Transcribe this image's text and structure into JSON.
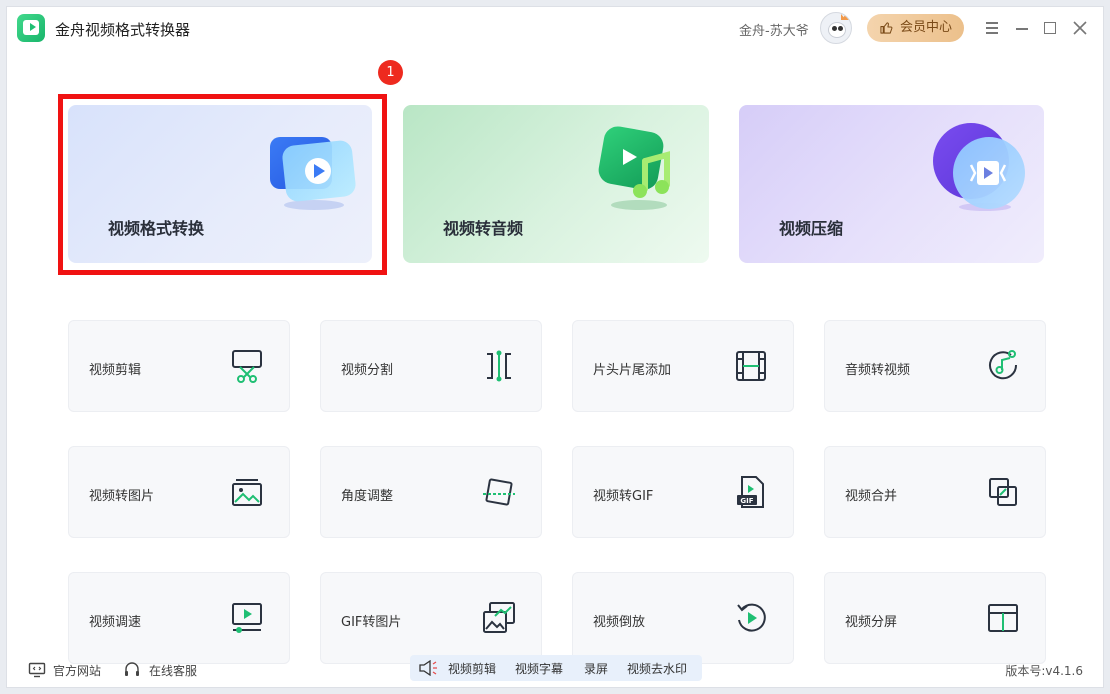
{
  "app": {
    "title": "金舟视频格式转换器"
  },
  "header": {
    "user_name": "金舟-苏大爷",
    "vip_label": "会员中心"
  },
  "annotation": {
    "step_number": "1"
  },
  "feature_cards": [
    {
      "label": "视频格式转换"
    },
    {
      "label": "视频转音频"
    },
    {
      "label": "视频压缩"
    }
  ],
  "tools": [
    {
      "label": "视频剪辑"
    },
    {
      "label": "视频分割"
    },
    {
      "label": "片头片尾添加"
    },
    {
      "label": "音频转视频"
    },
    {
      "label": "视频转图片"
    },
    {
      "label": "角度调整"
    },
    {
      "label": "视频转GIF"
    },
    {
      "label": "视频合并"
    },
    {
      "label": "视频调速"
    },
    {
      "label": "GIF转图片"
    },
    {
      "label": "视频倒放"
    },
    {
      "label": "视频分屏"
    }
  ],
  "footer": {
    "website": "官方网站",
    "support": "在线客服",
    "quick_links": [
      "视频剪辑",
      "视频字幕",
      "录屏",
      "视频去水印"
    ],
    "version": "版本号:v4.1.6"
  },
  "colors": {
    "accent_green": "#1fbf73",
    "highlight_red": "#f01212",
    "vip_gold": "#ecc08b"
  }
}
